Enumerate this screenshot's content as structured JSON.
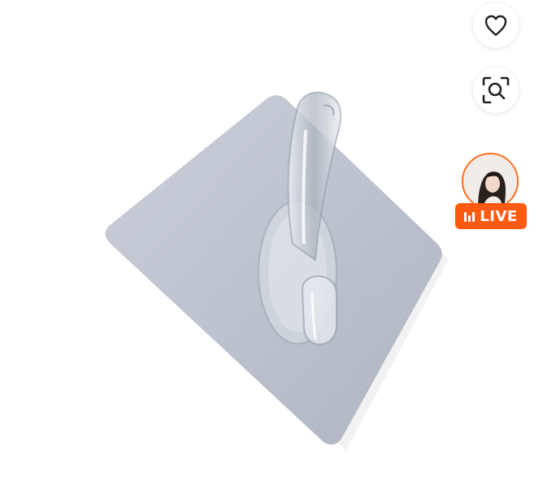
{
  "product": {
    "image_icon": "adhesive-wall-hook-image"
  },
  "actions": {
    "favorite_icon": "heart-icon",
    "image_search_icon": "image-search-icon"
  },
  "live": {
    "label": "LIVE",
    "icon": "live-bars-icon",
    "accent": "#ff5a12"
  }
}
